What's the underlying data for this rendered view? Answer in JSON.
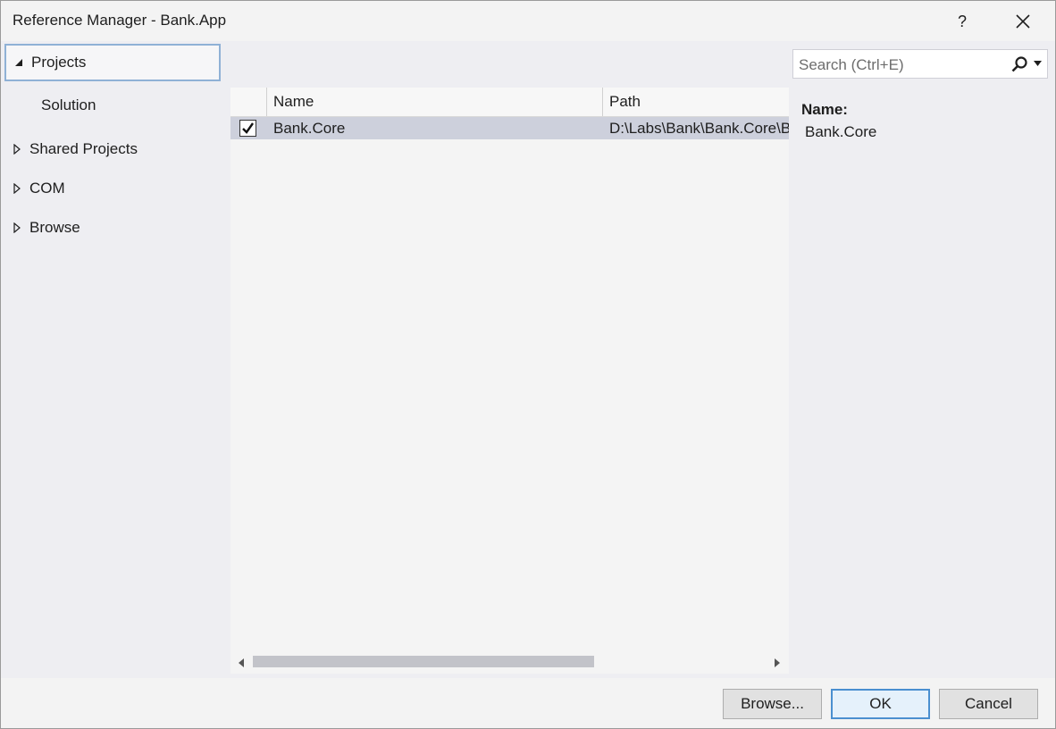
{
  "window": {
    "title": "Reference Manager - Bank.App"
  },
  "titlebar": {
    "help_label": "?"
  },
  "nav": {
    "items": [
      {
        "label": "Projects",
        "expanded": true,
        "selected": true
      },
      {
        "label": "Solution",
        "child": true
      },
      {
        "label": "Shared Projects",
        "expanded": false
      },
      {
        "label": "COM",
        "expanded": false
      },
      {
        "label": "Browse",
        "expanded": false
      }
    ]
  },
  "list": {
    "columns": [
      {
        "label": "Name"
      },
      {
        "label": "Path"
      }
    ],
    "rows": [
      {
        "checked": true,
        "name": "Bank.Core",
        "path": "D:\\Labs\\Bank\\Bank.Core\\Bank.Core.csproj"
      }
    ]
  },
  "search": {
    "placeholder": "Search (Ctrl+E)",
    "value": ""
  },
  "details": {
    "name_label": "Name:",
    "name_value": "Bank.Core"
  },
  "footer": {
    "browse_label": "Browse...",
    "ok_label": "OK",
    "cancel_label": "Cancel"
  },
  "icons": {
    "expanded": "triangle-down-right-icon",
    "collapsed": "triangle-right-outline-icon",
    "search": "magnifier-icon",
    "dropdown": "chevron-down-icon",
    "check": "checkmark-icon",
    "close": "close-icon"
  },
  "colors": {
    "selection_row": "#cdd0dc",
    "nav_selected_border": "#8fb1d6",
    "default_button_border": "#4a8fd0"
  }
}
